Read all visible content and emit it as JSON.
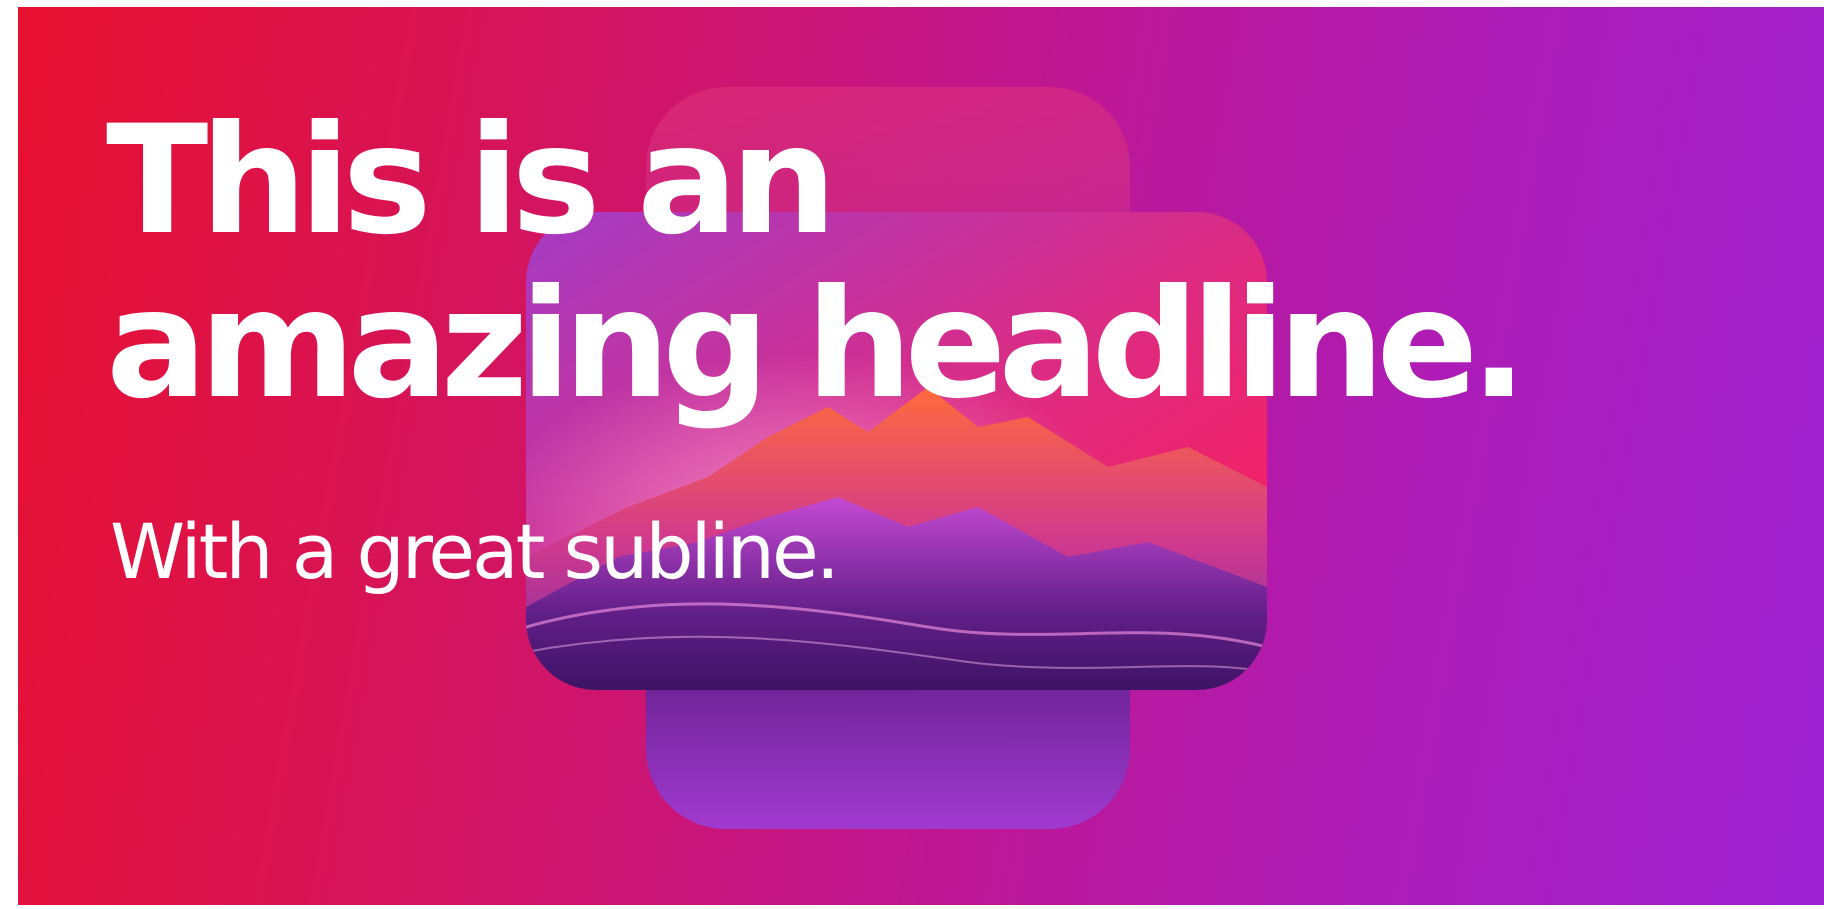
{
  "banner": {
    "headline_line1": "This is an",
    "headline_line2": "amazing headline.",
    "subline": "With a great subline."
  },
  "colors": {
    "gradient_start": "#e8102f",
    "gradient_end": "#9d22d3",
    "text": "#ffffff"
  },
  "artwork": {
    "icon": "mountain-landscape-icon"
  }
}
